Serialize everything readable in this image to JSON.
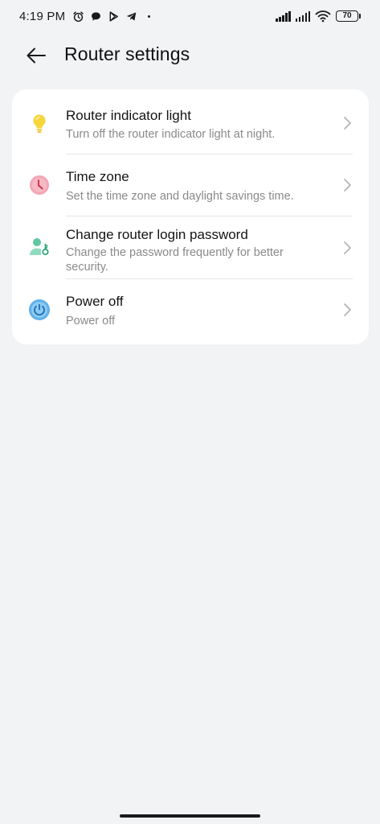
{
  "status_bar": {
    "time": "4:19 PM",
    "left_icons": [
      "alarm-icon",
      "chat-bubble-icon",
      "play-store-icon",
      "telegram-icon"
    ],
    "battery": "70"
  },
  "header": {
    "title": "Router settings",
    "back_icon": "back-arrow-icon"
  },
  "settings": [
    {
      "title": "Router indicator light",
      "subtitle": "Turn off the router indicator light at night.",
      "icon": "lightbulb-icon",
      "icon_color": "#f7d63c"
    },
    {
      "title": "Time zone",
      "subtitle": "Set the time zone and daylight savings time.",
      "icon": "clock-icon",
      "icon_color": "#f3a6b4"
    },
    {
      "title": "Change router login password",
      "subtitle": "Change the password frequently for better security.",
      "icon": "user-key-icon",
      "icon_color": "#5fc8a3"
    },
    {
      "title": "Power off",
      "subtitle": "Power off",
      "icon": "power-icon",
      "icon_color": "#5fb0e8"
    }
  ],
  "colors": {
    "background": "#f2f3f5",
    "card": "#ffffff",
    "subtitle": "#8a8a8a",
    "chevron": "#b5b5b5"
  }
}
